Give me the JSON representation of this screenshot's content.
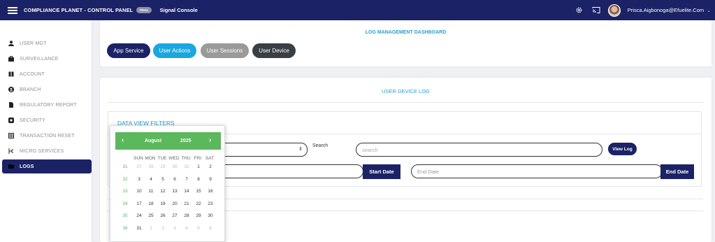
{
  "topbar": {
    "app_name": "COMPLIANCE PLANET - CONTROL PANEL",
    "trial_badge": "TRIAL",
    "console_name": "Signal Console",
    "user_email": "Prisca.Aigbonoga@Efuelite.Com",
    "icons": [
      "menu-icon",
      "settings-icon",
      "cast-icon",
      "avatar",
      "chevron-down-icon"
    ]
  },
  "sidebar": {
    "items": [
      {
        "label": "USER MGT",
        "icon": "user-icon"
      },
      {
        "label": "SURVEILLANCE",
        "icon": "briefcase-icon"
      },
      {
        "label": "ACCOUNT",
        "icon": "book-icon"
      },
      {
        "label": "BRANCH",
        "icon": "user-circle-icon"
      },
      {
        "label": "REGULATORY REPORT",
        "icon": "file-icon"
      },
      {
        "label": "SECURITY",
        "icon": "shield-icon"
      },
      {
        "label": "TRANSACTION RESET",
        "icon": "grid-icon"
      },
      {
        "label": "MICRO SERVICES",
        "icon": "microservice-icon"
      },
      {
        "label": "LOGS",
        "icon": "folder-icon",
        "active": true
      }
    ]
  },
  "dashboard": {
    "title": "LOG MANAGEMENT DASHBOARD",
    "buttons": [
      {
        "label": "App Service",
        "color": "#1b2266"
      },
      {
        "label": "User Actions",
        "color": "#1aa7e0"
      },
      {
        "label": "User Sessions",
        "color": "#9a9a9a"
      },
      {
        "label": "User Device",
        "color": "#3a3f44"
      }
    ]
  },
  "log": {
    "title": "USER DEVICE LOG",
    "filters_title": "DATA VIEW FILTERS",
    "search_label": "Search",
    "search_placeholder": "search",
    "view_log_label": "View Log",
    "start_date_label": "Start Date",
    "end_date_placeholder": "End Date",
    "end_date_label": "End Date"
  },
  "calendar": {
    "prev": "‹",
    "next": "›",
    "month": "August",
    "year": "2025",
    "weekdays": [
      "SUN",
      "MON",
      "TUE",
      "WED",
      "THU",
      "FRI",
      "SAT"
    ],
    "weeks": [
      {
        "wk": "31",
        "days": [
          "27",
          "28",
          "29",
          "30",
          "31",
          "1",
          "2"
        ],
        "dim": [
          true,
          true,
          true,
          true,
          true,
          false,
          false
        ]
      },
      {
        "wk": "32",
        "days": [
          "3",
          "4",
          "5",
          "6",
          "7",
          "8",
          "9"
        ],
        "dim": [
          false,
          false,
          false,
          false,
          false,
          false,
          false
        ]
      },
      {
        "wk": "33",
        "days": [
          "10",
          "11",
          "12",
          "13",
          "14",
          "15",
          "16"
        ],
        "dim": [
          false,
          false,
          false,
          false,
          false,
          false,
          false
        ]
      },
      {
        "wk": "34",
        "days": [
          "17",
          "18",
          "19",
          "20",
          "21",
          "22",
          "23"
        ],
        "dim": [
          false,
          false,
          false,
          false,
          false,
          false,
          false
        ]
      },
      {
        "wk": "35",
        "days": [
          "24",
          "25",
          "26",
          "27",
          "28",
          "29",
          "30"
        ],
        "dim": [
          false,
          false,
          false,
          false,
          false,
          false,
          false
        ]
      },
      {
        "wk": "36",
        "days": [
          "31",
          "1",
          "2",
          "3",
          "4",
          "5",
          "6"
        ],
        "dim": [
          false,
          true,
          true,
          true,
          true,
          true,
          true
        ]
      }
    ]
  }
}
